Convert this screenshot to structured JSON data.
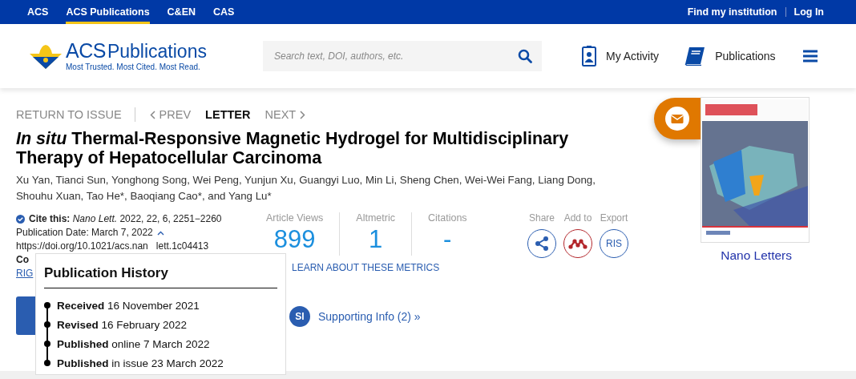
{
  "top_nav": {
    "sites": [
      {
        "label": "ACS",
        "selected": false
      },
      {
        "label": "ACS Publications",
        "selected": true
      },
      {
        "label": "C&EN",
        "selected": false
      },
      {
        "label": "CAS",
        "selected": false
      }
    ],
    "links": [
      "Find my institution",
      "Log In"
    ]
  },
  "header": {
    "logo": {
      "mark": "ACS",
      "word": "Publications",
      "tagline": "Most Trusted. Most Cited. Most Read."
    },
    "search": {
      "placeholder": "Search text, DOI, authors, etc."
    },
    "actions": [
      {
        "label": "My Activity",
        "kind": "activity"
      },
      {
        "label": "Publications",
        "kind": "book"
      }
    ]
  },
  "breadcrumb": {
    "return": "RETURN TO ISSUE",
    "prev": "PREV",
    "type": "LETTER",
    "next": "NEXT"
  },
  "title": "*In situ* Thermal-Responsive Magnetic Hydrogel for Multidisciplinary Therapy of Hepatocellular Carcinoma",
  "authors": "Xu Yan, Tianci Sun, Yonghong Song, Wei Peng, Yunjun Xu, Guangyi Luo, Min Li, Sheng Chen, Wei-Wei Fang, Liang Dong, Shouhu Xuan, Tao He*, Baoqiang Cao*, and Yang Lu*",
  "cite": "**Cite this:** *Nano Lett.*   2022, 22, 6, 2251−2260",
  "publication_date": {
    "text": "Publication Date: March 7, 2022",
    "expanded": true
  },
  "doi": [
    "https://doi.org/10.1021/acs.nan",
    "lett.1c04413"
  ],
  "copyright_partial": "Co",
  "rights_partial": "RIG",
  "metrics": [
    {
      "label": "Article Views",
      "value": "899"
    },
    {
      "label": "Altmetric",
      "value": "1"
    },
    {
      "label": "Citations",
      "value": "-"
    }
  ],
  "metrics_link": "LEARN ABOUT THESE METRICS",
  "tools": [
    {
      "label": "Share",
      "kind": "share"
    },
    {
      "label": "Add to",
      "kind": "mendeley"
    },
    {
      "label": "Export",
      "kind": "ris",
      "text": "RIS"
    }
  ],
  "supporting": {
    "badge": "SI",
    "label": "Supporting Info (2) »"
  },
  "cover": {
    "caption": "Nano Letters"
  },
  "history": {
    "title": "Publication History",
    "events": [
      {
        "label": "Received",
        "date": "16 November 2021"
      },
      {
        "label": "Revised",
        "date": "16 February 2022"
      },
      {
        "label": "Published",
        "date": "online 7 March 2022"
      },
      {
        "label": "Published",
        "date": "in issue 23 March 2022"
      }
    ]
  }
}
